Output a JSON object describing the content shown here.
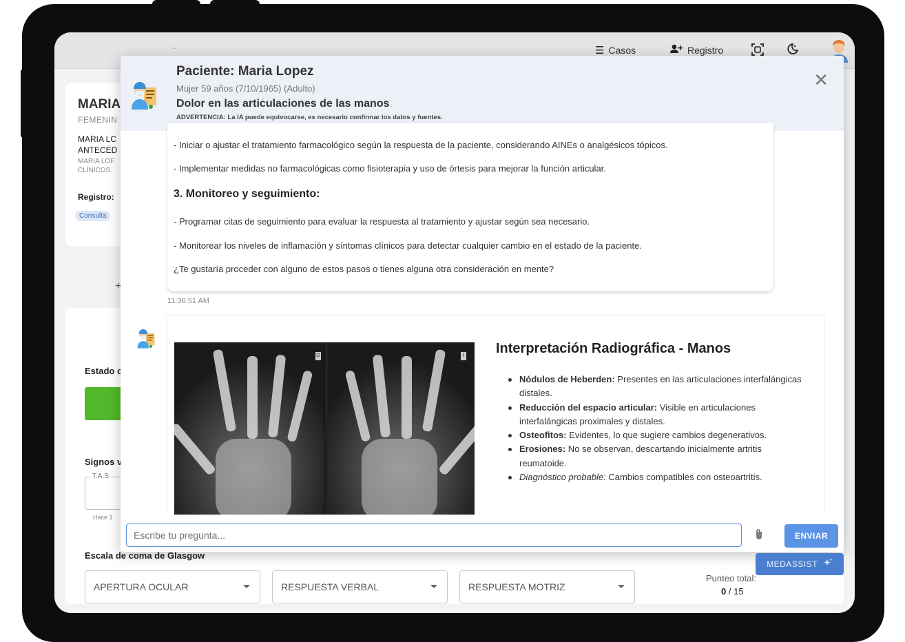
{
  "topbar": {
    "dot": "-",
    "cases_label": "Casos",
    "register_label": "Registro"
  },
  "background": {
    "patient_name_trunc": "MARIA",
    "sex_trunc": "FEMENIN",
    "line1_trunc": "MARIA LC",
    "line2_trunc": "ANTECED",
    "line3_trunc": "MARIA LOF",
    "line4_trunc": "CLÍNICOS.",
    "registro_label": "Registro:",
    "chip_label": "Consulta",
    "plus": "+",
    "estado_trunc": "Estado c",
    "signos_trunc": "Signos v",
    "tas_label": "T.A.S",
    "hace_trunc": "Hace 1",
    "glasgow_title": "Escala de coma de Glasgow",
    "select_ocular": "APERTURA OCULAR",
    "select_verbal": "RESPUESTA VERBAL",
    "select_motriz": "RESPUESTA MOTRIZ",
    "punteo_label": "Punteo total:",
    "punteo_value": "0",
    "punteo_max": "/ 15"
  },
  "modal": {
    "patient_title": "Paciente: Maria Lopez",
    "patient_info": "Mujer 59 años (7/10/1965) (Adulto)",
    "complaint": "Dolor en las articulaciones de las manos",
    "warning": "ADVERTENCIA: La IA puede equivocarse, es necesario confirmar los datos y fuentes.",
    "close": "✕"
  },
  "message1": {
    "line1": "- Iniciar o ajustar el tratamiento farmacológico según la respuesta de la paciente, considerando AINEs o analgésicos tópicos.",
    "line2": "- Implementar medidas no farmacológicas como fisioterapia y uso de órtesis para mejorar la función articular.",
    "heading": "3. Monitoreo y seguimiento:",
    "line3": "- Programar citas de seguimiento para evaluar la respuesta al tratamiento y ajustar según sea necesario.",
    "line4": "- Monitorear los niveles de inflamación y síntomas clínicos para detectar cualquier cambio en el estado de la paciente.",
    "line5": "¿Te gustaría proceder con alguno de estos pasos o tienes alguna otra consideración en mente?",
    "timestamp": "11:36:51 AM"
  },
  "message2": {
    "xray_tag_left": "D",
    "xray_tag_right": "I",
    "title": "Interpretación Radiográfica - Manos",
    "items": [
      {
        "label": "Nódulos de Heberden:",
        "text": " Presentes en las articulaciones interfalángicas distales."
      },
      {
        "label": "Reducción del espacio articular:",
        "text": " Visible en articulaciones interfalángicas proximales y distales."
      },
      {
        "label": "Osteofitos:",
        "text": " Evidentes, lo que sugiere cambios degenerativos."
      },
      {
        "label": "Erosiones:",
        "text": " No se observan, descartando inicialmente artritis reumatoide."
      }
    ],
    "diag_label": "Diagnóstico probable:",
    "diag_text": " Cambios compatibles con osteoartritis."
  },
  "chat": {
    "placeholder": "Escribe tu pregunta...",
    "send_label": "ENVIAR"
  },
  "medassist_label": "MEDASSIST",
  "colors": {
    "accent": "#5b93e6",
    "medassist": "#4a7fcf",
    "header_bg": "#eef0f7",
    "green": "#52b82a"
  }
}
